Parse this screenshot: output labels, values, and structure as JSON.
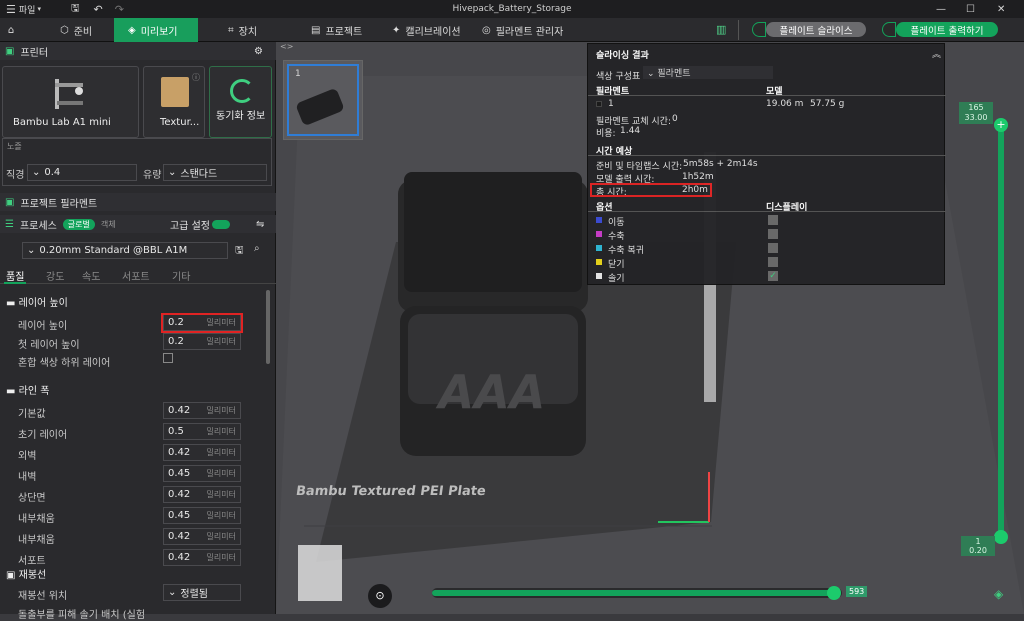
{
  "title": "Hivepack_Battery_Storage",
  "menu": {
    "file": "파일"
  },
  "tabs": {
    "prepare": "준비",
    "preview": "미리보기",
    "device": "장치",
    "project": "프로젝트",
    "calibration": "캘리브레이션",
    "filament_manager": "필라멘트 관리자"
  },
  "actions": {
    "slice_plate": "플레이트 슬라이스",
    "print_plate": "플레이트 출력하기"
  },
  "printer": {
    "header": "프린터",
    "name": "Bambu Lab A1 mini",
    "plate": "Textur...",
    "sync": "동기화 정보",
    "nozzle_label": "노즐",
    "diameter_label": "직경",
    "diameter": "0.4",
    "flow_label": "유량",
    "flow": "스탠다드"
  },
  "filament": {
    "header": "프로젝트 필라멘트"
  },
  "process": {
    "header": "프로세스",
    "global": "글로벌",
    "object": "객체",
    "advanced": "고급 설정",
    "profile": "0.20mm Standard @BBL A1M",
    "tabs": [
      "품질",
      "강도",
      "속도",
      "서포트",
      "기타"
    ]
  },
  "layer_height": {
    "title": "레이어 높이",
    "rows": [
      {
        "label": "레이어 높이",
        "value": "0.2",
        "unit": "밀리미터"
      },
      {
        "label": "첫 레이어 높이",
        "value": "0.2",
        "unit": "밀리미터"
      }
    ],
    "mixed_label": "혼합 색상 하위 레이어"
  },
  "line_width": {
    "title": "라인 폭",
    "unit": "밀리미터",
    "rows": [
      {
        "label": "기본값",
        "value": "0.42"
      },
      {
        "label": "초기 레이어",
        "value": "0.5"
      },
      {
        "label": "외벽",
        "value": "0.42"
      },
      {
        "label": "내벽",
        "value": "0.45"
      },
      {
        "label": "상단면",
        "value": "0.42"
      },
      {
        "label": "내부채움",
        "value": "0.45"
      },
      {
        "label": "내부채움",
        "value": "0.42"
      },
      {
        "label": "서포트",
        "value": "0.42"
      }
    ]
  },
  "seam": {
    "title": "재봉선",
    "position_label": "재봉선 위치",
    "position": "정렬됨",
    "cut_label": "돌출부를 피해 솔기 배치 (실험"
  },
  "stats": {
    "title": "슬라이싱 결과",
    "color_scheme_label": "색상 구성표",
    "color_scheme": "필라멘트",
    "col_filament": "필라멘트",
    "col_model": "모델",
    "filament_id": "1",
    "model_len": "19.06 m",
    "model_weight": "57.75 g",
    "change_label": "필라멘트 교체 시간:",
    "change_value": "0",
    "cost_label": "비용:",
    "cost_value": "1.44",
    "time_header": "시간 예상",
    "prep_label": "준비 및 타임랩스 시간:",
    "prep_value": "5m58s + 2m14s",
    "model_time_label": "모델 출력 시간:",
    "model_time_value": "1h52m",
    "total_label": "총 시간:",
    "total_value": "2h0m",
    "options_label": "옵션",
    "display_label": "디스플레이",
    "options": [
      {
        "name": "이동",
        "color": "#3b4bd6",
        "checked": false
      },
      {
        "name": "수축",
        "color": "#c93cc9",
        "checked": false
      },
      {
        "name": "수축 복귀",
        "color": "#2fb8d6",
        "checked": false
      },
      {
        "name": "닫기",
        "color": "#e8d41a",
        "checked": false
      },
      {
        "name": "솔기",
        "color": "#e8e8e8",
        "checked": true
      }
    ]
  },
  "viewport": {
    "plate_label": "Bambu Textured PEI Plate",
    "thumb_num": "1",
    "model_text": "AAA",
    "top_layer": "165",
    "top_height": "33.00",
    "bottom_layer": "1",
    "bottom_height": "0.20",
    "hslider_value": "593",
    "hslider_progress": 0.98
  }
}
